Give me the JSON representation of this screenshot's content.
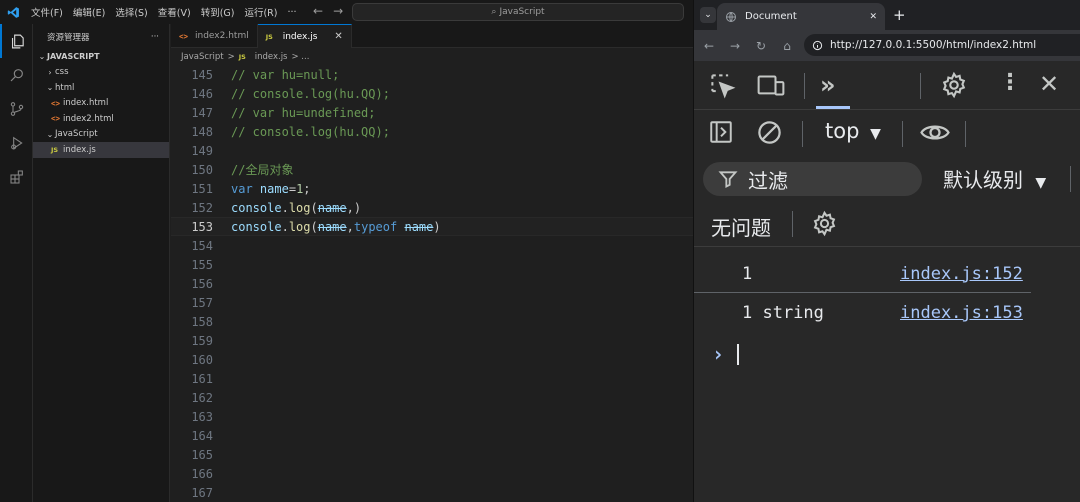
{
  "vscode": {
    "menu": [
      "文件(F)",
      "编辑(E)",
      "选择(S)",
      "查看(V)",
      "转到(G)",
      "运行(R)",
      "···"
    ],
    "search_placeholder": "JavaScript",
    "explorer_title": "资源管理器",
    "explorer_more": "···",
    "tree": [
      {
        "label": "JAVASCRIPT",
        "kind": "root"
      },
      {
        "label": "css",
        "kind": "folder"
      },
      {
        "label": "html",
        "kind": "folder"
      },
      {
        "label": "index.html",
        "kind": "html"
      },
      {
        "label": "index2.html",
        "kind": "html"
      },
      {
        "label": "JavaScript",
        "kind": "folder"
      },
      {
        "label": "index.js",
        "kind": "js"
      }
    ],
    "tabs": [
      {
        "label": "index2.html",
        "icon": "<>"
      },
      {
        "label": "index.js",
        "icon": "JS",
        "close": "✕"
      }
    ],
    "breadcrumb": {
      "folder": "JavaScript",
      "sep": ">",
      "icon": "JS",
      "file": "index.js",
      "tail": "> ..."
    },
    "line_numbers": [
      "145",
      "146",
      "147",
      "148",
      "149",
      "150",
      "151",
      "152",
      "153",
      "154",
      "155",
      "156",
      "157",
      "158",
      "159",
      "160",
      "161",
      "162",
      "163",
      "164",
      "165",
      "166",
      "167"
    ],
    "code": {
      "l145": "// var hu=null;",
      "l146": "// console.log(hu.QQ);",
      "l147": "// var hu=undefined;",
      "l148": "// console.log(hu.QQ);",
      "l150": "//全局对象",
      "l151_kw": "var",
      "l151_name": "name",
      "l151_op": "=",
      "l151_num": "1",
      "l151_end": ";",
      "console": "console",
      "dot": ".",
      "log": "log",
      "paren_open": "(",
      "name": "name",
      "comma": ",",
      "paren_close": ")",
      "typeof": "typeof",
      "space": " "
    }
  },
  "browser": {
    "tab_title": "Document",
    "tab_close": "✕",
    "new_tab": "+",
    "url": "http://127.0.0.1:5500/html/index2.html",
    "context": "top",
    "filter_label": "过滤",
    "level": "默认级别",
    "no_issues": "无问题",
    "console_rows": [
      {
        "value": "1",
        "source": "index.js:152"
      },
      {
        "value": "1 string",
        "source": "index.js:153"
      }
    ],
    "prompt": "›"
  },
  "colors": {
    "accent": "#0078d4",
    "comment": "#6a9955",
    "keyword": "#569cd6",
    "variable": "#9cdcfe",
    "function": "#dcdcaa",
    "number": "#b5cea8",
    "link": "#a8c7fa"
  }
}
